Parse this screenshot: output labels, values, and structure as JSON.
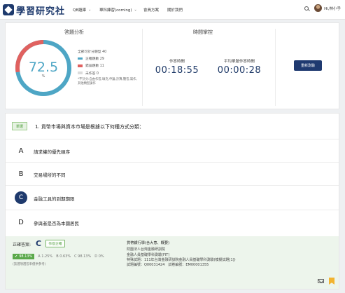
{
  "nav": {
    "logo_text": "學習研究社",
    "items": [
      {
        "label": "QB題庫",
        "has_caret": true
      },
      {
        "label": "單科練習(coming)",
        "has_caret": true
      },
      {
        "label": "會員方案",
        "has_caret": false
      },
      {
        "label": "關於我們",
        "has_caret": false
      }
    ],
    "user_name": "Hi,林小手",
    "caret": "⌄"
  },
  "analysis": {
    "title": "答題分析",
    "score": "72.5",
    "unit": "%",
    "legend_header": "全部可計分題型 40",
    "legend": [
      {
        "label": "正確題數 29",
        "color": "#4ea6c5"
      },
      {
        "label": "錯誤題數 11",
        "color": "#e0615f"
      },
      {
        "label": "未作答 0",
        "color": "#dcdcdc"
      }
    ],
    "correct_count": 29,
    "wrong_count": 11,
    "unanswered_count": 0,
    "note": "*不計分:自由作答,填充,申論,計算,簡答,寫作,其他類型操作"
  },
  "time": {
    "title": "時間掌控",
    "elapsed_label": "作答時間",
    "elapsed_value": "00:18:55",
    "avg_label": "平均單題作答時間",
    "avg_value": "00:00:28",
    "retest_label": "重新測驗"
  },
  "question": {
    "badge": "單選",
    "text": "1. 貨幣市場與資本市場是根據以下何種方式分類：",
    "options": [
      {
        "letter": "A",
        "text": "請求權的優先順序",
        "correct": false
      },
      {
        "letter": "B",
        "text": "交易場所的不同",
        "correct": false
      },
      {
        "letter": "C",
        "text": "金融工具的到期期限",
        "correct": true
      },
      {
        "letter": "D",
        "text": "參與者是否為本國居民",
        "correct": false
      }
    ]
  },
  "answer": {
    "label": "正確答案:",
    "letter": "C",
    "status_button": "作答正確",
    "correct_pct": "98.13%",
    "check": "✔",
    "pct_others": [
      "A 1.25%",
      "B 0.63%",
      "C 98.13%",
      "D 0%"
    ],
    "pct_note": "(該選項選答率僅供參考)",
    "source_title": "貨幣銀行學(含大意、概要)",
    "source_lines": [
      "財團法人台灣金融研訓院",
      "金融人員基礎學科測驗(FIT)",
      "特殊試題：111年台灣金融研訓院金融人員基礎學科測驗(模擬試題[1])",
      "試題編號：Q00031424　試卷編號：EM00001355"
    ]
  }
}
